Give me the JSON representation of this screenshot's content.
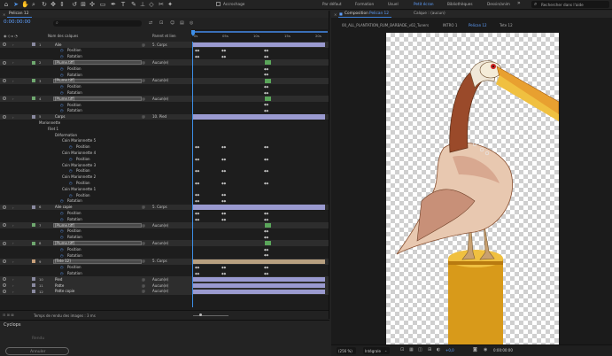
{
  "toolbar": {
    "snap_label": "Accrochage",
    "workspaces": [
      "Par défaut",
      "Formation",
      "Usuel",
      "Petit écran",
      "Bibliothèques",
      "Dessin/anim"
    ],
    "active_workspace": "Petit écran",
    "search_placeholder": "Rechercher dans l'aide"
  },
  "timeline": {
    "tab": "Pelican 12",
    "timecode": "0:00:00:00",
    "search_placeholder": "⌕",
    "col_source": "Nom des calques",
    "col_parent": "Parent et lien",
    "ruler": [
      "0s",
      "05s",
      "10s",
      "15s",
      "20s"
    ],
    "footer": "Temps de rendu des images : 3 ms",
    "layers": [
      {
        "num": "1",
        "name": "Aile",
        "parent": "5. Corps",
        "kind": "layer",
        "sel": false,
        "color": "#8a8aa0",
        "bar": "#9a9ad0",
        "keys": []
      },
      {
        "num": "",
        "name": "Position",
        "parent": "",
        "kind": "prop",
        "keys": [
          "220",
          "250",
          "298"
        ]
      },
      {
        "num": "",
        "name": "Rotation",
        "parent": "",
        "kind": "prop",
        "keys": [
          "220",
          "250",
          "298"
        ]
      },
      {
        "num": "2",
        "name": "[Plume.tiff]",
        "parent": "Aucun(e)",
        "kind": "layer",
        "sel": true,
        "color": "#6fa86f",
        "bar": "",
        "keys": [],
        "green": true
      },
      {
        "num": "",
        "name": "Position",
        "parent": "",
        "kind": "prop",
        "keys": [
          "298"
        ]
      },
      {
        "num": "",
        "name": "Rotation",
        "parent": "",
        "kind": "prop",
        "keys": [
          "298"
        ]
      },
      {
        "num": "3",
        "name": "[Plume.tiff]",
        "parent": "Aucun(e)",
        "kind": "layer",
        "sel": true,
        "color": "#6fa86f",
        "bar": "",
        "keys": [],
        "green": true
      },
      {
        "num": "",
        "name": "Position",
        "parent": "",
        "kind": "prop",
        "keys": [
          "298"
        ]
      },
      {
        "num": "",
        "name": "Rotation",
        "parent": "",
        "kind": "prop",
        "keys": [
          "298"
        ]
      },
      {
        "num": "4",
        "name": "[Plume.tiff]",
        "parent": "Aucun(e)",
        "kind": "layer",
        "sel": true,
        "color": "#6fa86f",
        "bar": "",
        "keys": [],
        "green": true
      },
      {
        "num": "",
        "name": "Position",
        "parent": "",
        "kind": "prop",
        "keys": [
          "298"
        ]
      },
      {
        "num": "",
        "name": "Rotation",
        "parent": "",
        "kind": "prop",
        "keys": [
          "298"
        ]
      },
      {
        "num": "5",
        "name": "Corps",
        "parent": "10. Pied",
        "kind": "layer",
        "sel": false,
        "color": "#8a8aa0",
        "bar": "#9a9ad0",
        "keys": []
      },
      {
        "num": "",
        "name": "Marionnette",
        "parent": "",
        "kind": "group",
        "indent": 44,
        "keys": []
      },
      {
        "num": "",
        "name": "Filet 1",
        "parent": "",
        "kind": "group",
        "indent": 54,
        "keys": []
      },
      {
        "num": "",
        "name": "Déformation",
        "parent": "",
        "kind": "group",
        "indent": 62,
        "keys": []
      },
      {
        "num": "",
        "name": "Coin Marionnette 5",
        "parent": "",
        "kind": "group",
        "indent": 70,
        "keys": []
      },
      {
        "num": "",
        "name": "Position",
        "parent": "",
        "kind": "prop",
        "indent": 86,
        "keys": [
          "220",
          "250",
          "298"
        ]
      },
      {
        "num": "",
        "name": "Coin Marionnette 4",
        "parent": "",
        "kind": "group",
        "indent": 70,
        "keys": []
      },
      {
        "num": "",
        "name": "Position",
        "parent": "",
        "kind": "prop",
        "indent": 86,
        "keys": [
          "220",
          "250",
          "298"
        ]
      },
      {
        "num": "",
        "name": "Coin Marionnette 3",
        "parent": "",
        "kind": "group",
        "indent": 70,
        "keys": []
      },
      {
        "num": "",
        "name": "Position",
        "parent": "",
        "kind": "prop",
        "indent": 86,
        "keys": [
          "220",
          "250",
          "298"
        ]
      },
      {
        "num": "",
        "name": "Coin Marionnette 2",
        "parent": "",
        "kind": "group",
        "indent": 70,
        "keys": []
      },
      {
        "num": "",
        "name": "Position",
        "parent": "",
        "kind": "prop",
        "indent": 86,
        "keys": [
          "220",
          "250",
          "298"
        ]
      },
      {
        "num": "",
        "name": "Coin Marionnette 1",
        "parent": "",
        "kind": "group",
        "indent": 70,
        "keys": []
      },
      {
        "num": "",
        "name": "Position",
        "parent": "",
        "kind": "prop",
        "indent": 86,
        "keys": [
          "220",
          "250"
        ]
      },
      {
        "num": "",
        "name": "Rotation",
        "parent": "",
        "kind": "prop",
        "keys": [
          "220",
          "250"
        ]
      },
      {
        "num": "6",
        "name": "Aile copie",
        "parent": "5. Corps",
        "kind": "layer",
        "sel": false,
        "color": "#8a8aa0",
        "bar": "#9a9ad0",
        "keys": []
      },
      {
        "num": "",
        "name": "Position",
        "parent": "",
        "kind": "prop",
        "keys": [
          "220",
          "250",
          "298"
        ]
      },
      {
        "num": "",
        "name": "Rotation",
        "parent": "",
        "kind": "prop",
        "keys": [
          "220",
          "250",
          "298"
        ]
      },
      {
        "num": "7",
        "name": "[Plume.tiff]",
        "parent": "Aucun(e)",
        "kind": "layer",
        "sel": true,
        "color": "#6fa86f",
        "bar": "",
        "keys": [],
        "green": true
      },
      {
        "num": "",
        "name": "Position",
        "parent": "",
        "kind": "prop",
        "keys": [
          "298"
        ]
      },
      {
        "num": "",
        "name": "Rotation",
        "parent": "",
        "kind": "prop",
        "keys": [
          "298"
        ]
      },
      {
        "num": "8",
        "name": "[Plume.tiff]",
        "parent": "Aucun(e)",
        "kind": "layer",
        "sel": true,
        "color": "#6fa86f",
        "bar": "",
        "keys": [],
        "green": true
      },
      {
        "num": "",
        "name": "Position",
        "parent": "",
        "kind": "prop",
        "keys": [
          "298"
        ]
      },
      {
        "num": "",
        "name": "Rotation",
        "parent": "",
        "kind": "prop",
        "keys": [
          "298"
        ]
      },
      {
        "num": "9",
        "name": "[Tete 12]",
        "parent": "5. Corps",
        "kind": "layer",
        "sel": true,
        "color": "#c8a07a",
        "bar": "#b8a080",
        "keys": []
      },
      {
        "num": "",
        "name": "Position",
        "parent": "",
        "kind": "prop",
        "keys": [
          "220",
          "250",
          "298"
        ]
      },
      {
        "num": "",
        "name": "Rotation",
        "parent": "",
        "kind": "prop",
        "keys": [
          "220",
          "250",
          "298"
        ]
      },
      {
        "num": "10",
        "name": "Pied",
        "parent": "Aucun(e)",
        "kind": "layer",
        "sel": false,
        "color": "#8a8aa0",
        "bar": "#9a9ad0",
        "keys": []
      },
      {
        "num": "11",
        "name": "Patte",
        "parent": "Aucun(e)",
        "kind": "layer",
        "sel": false,
        "color": "#8a8aa0",
        "bar": "#9a9ad0",
        "keys": []
      },
      {
        "num": "12",
        "name": "Patte copie",
        "parent": "Aucun(e)",
        "kind": "layer",
        "sel": false,
        "color": "#8a8aa0",
        "bar": "#9a9ad0",
        "keys": []
      }
    ]
  },
  "bottom": {
    "title": "Cyclops",
    "btn1": "Rendu",
    "btn2": "Annuler"
  },
  "comp": {
    "tab_label": "Composition",
    "tab_name": "Pelican 12",
    "layer_tab": "Calque : (aucun)",
    "breadcrumbs": [
      "00_ALL_PLANTATION_RUM_BARBADE_v02_Tuners",
      "INTRO 1",
      "Pelican 12",
      "Tete 12"
    ],
    "active_crumb": "Pelican 12",
    "zoom": "(256 %)",
    "quality": "Intégrale",
    "timecode": "0:00:00:00",
    "offset": "+0,0"
  }
}
